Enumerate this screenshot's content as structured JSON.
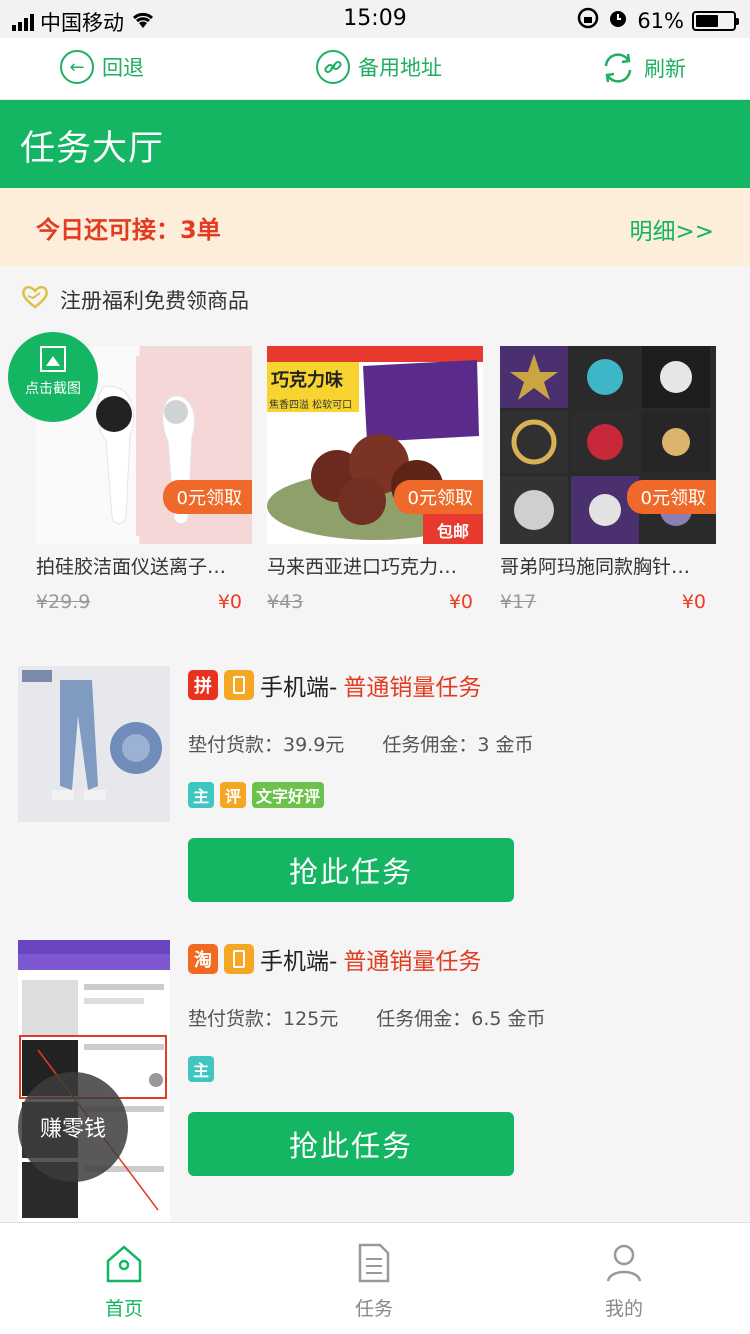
{
  "status_bar": {
    "carrier": "中国移动",
    "time": "15:09",
    "battery": "61%",
    "battery_level": 0.61
  },
  "top_nav": {
    "back": "回退",
    "backup_address": "备用地址",
    "refresh": "刷新"
  },
  "header": {
    "title": "任务大厅"
  },
  "quota": {
    "label": "今日还可接：3单",
    "detail": "明细>>"
  },
  "promo": {
    "title": "注册福利免费领商品",
    "screenshot_button": "点击截图",
    "products": [
      {
        "name": "拍硅胶洁面仪送离子导入仪",
        "tag": "0元领取",
        "old_price": "¥29.9",
        "price": "¥0"
      },
      {
        "name": "马来西亚进口巧克力味饼干",
        "tag": "0元领取",
        "old_price": "¥43",
        "price": "¥0",
        "img_banner": "巧克力味",
        "img_sub": "焦香四溢 松软可口",
        "img_badge": "包邮"
      },
      {
        "name": "哥弟阿玛施同款胸针别针",
        "tag": "0元领取",
        "old_price": "¥17",
        "price": "¥0"
      }
    ]
  },
  "tasks": [
    {
      "platform": "拼",
      "platform_color": "#e8321e",
      "device": "手机端-",
      "type": "普通销量任务",
      "advance": "垫付货款：39.9元",
      "commission": "任务佣金：3 金币",
      "badges": [
        {
          "text": "主",
          "color": "#3fc6c0"
        },
        {
          "text": "评",
          "color": "#f5a623"
        },
        {
          "text": "文字好评",
          "color": "#6cc24a"
        }
      ],
      "button": "抢此任务"
    },
    {
      "platform": "淘",
      "platform_color": "#f26a21",
      "device": "手机端-",
      "type": "普通销量任务",
      "advance": "垫付货款：125元",
      "commission": "任务佣金：6.5 金币",
      "badges": [
        {
          "text": "主",
          "color": "#3fc6c0"
        }
      ],
      "button": "抢此任务"
    }
  ],
  "earn_button": "赚零钱",
  "tabbar": {
    "home": "首页",
    "tasks": "任务",
    "mine": "我的"
  },
  "colors": {
    "primary": "#14b563",
    "accent_red": "#e23b1f",
    "quota_bg": "#fdeedb"
  }
}
